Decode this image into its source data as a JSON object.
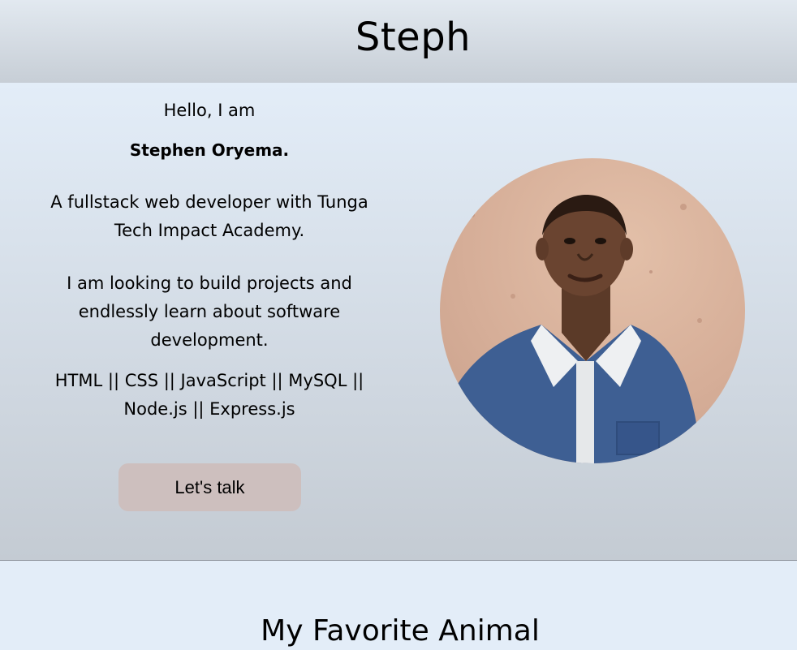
{
  "header": {
    "title": "Steph"
  },
  "hero": {
    "greeting": "Hello, I am",
    "name": "Stephen Oryema.",
    "description_1": "A fullstack web developer with Tunga Tech Impact Academy.",
    "description_2": "I am looking to build projects and endlessly learn about software development.",
    "skills": "HTML || CSS || JavaScript || MySQL || Node.js || Express.js",
    "cta_label": "Let's talk",
    "colors": {
      "cta_background": "#cdbfbe",
      "avatar_wall": "#d9b19b",
      "shirt": "#3e5f93"
    }
  },
  "section": {
    "title": "My Favorite Animal"
  }
}
